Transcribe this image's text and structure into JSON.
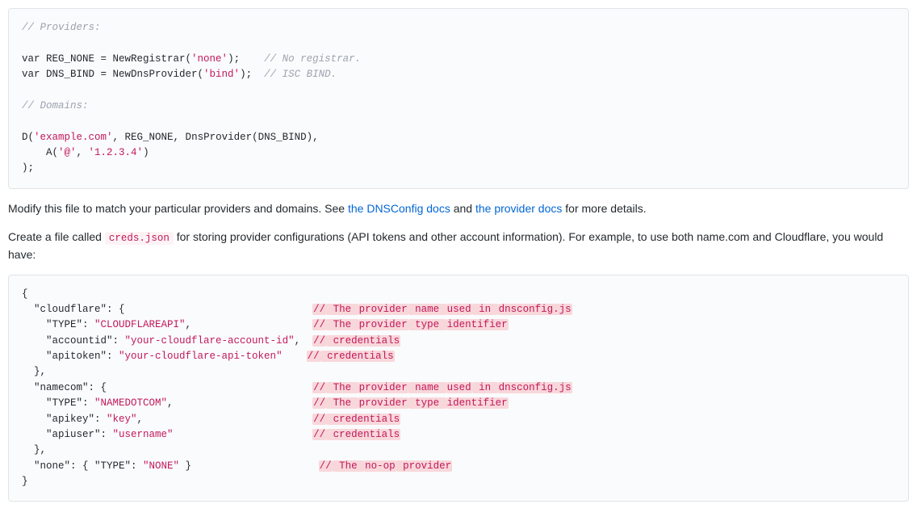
{
  "code1": {
    "c1": "// Providers:",
    "l1a": "var REG_NONE = NewRegistrar(",
    "l1s": "'none'",
    "l1b": ");    ",
    "l1c": "// No registrar.",
    "l2a": "var DNS_BIND = NewDnsProvider(",
    "l2s": "'bind'",
    "l2b": ");  ",
    "l2c": "// ISC BIND.",
    "c2": "// Domains:",
    "l3a": "D(",
    "l3s": "'example.com'",
    "l3b": ", REG_NONE, DnsProvider(DNS_BIND),",
    "l4a": "    A(",
    "l4s1": "'@'",
    "l4m": ", ",
    "l4s2": "'1.2.3.4'",
    "l4b": ")",
    "l5": ");"
  },
  "p1": {
    "t1": "Modify this file to match your particular providers and domains. See ",
    "link1": "the DNSConfig docs",
    "t2": " and ",
    "link2": "the provider docs",
    "t3": " for more details."
  },
  "p2": {
    "t1": "Create a file called ",
    "code": "creds.json",
    "t2": " for storing provider configurations (API tokens and other account information). For example, to use both name.com and Cloudflare, you would have:"
  },
  "code2": {
    "open": "{",
    "cf_k": "  \"cloudflare\": {                               ",
    "cf_c": [
      "//",
      " The ",
      "provider",
      " name ",
      "used",
      " in ",
      "dnsconfig.js"
    ],
    "cf_t": "    \"TYPE\": ",
    "cf_tv": "\"CLOUDFLAREAPI\"",
    "cf_tp": ",                    ",
    "cf_tc": [
      "//",
      " The ",
      "provider",
      " type ",
      "identifier"
    ],
    "cf_a": "    \"accountid\": ",
    "cf_av": "\"your-cloudflare-account-id\"",
    "cf_ap": ",  ",
    "cf_ac": [
      "//",
      " credentials"
    ],
    "cf_p": "    \"apitoken\": ",
    "cf_pv": "\"your-cloudflare-api-token\"",
    "cf_pp": "    ",
    "cf_pc": [
      "//",
      " credentials"
    ],
    "cf_close": "  },",
    "nc_k": "  \"namecom\": {                                  ",
    "nc_c": [
      "//",
      " The ",
      "provider",
      " name ",
      "used",
      " in ",
      "dnsconfig.js"
    ],
    "nc_t": "    \"TYPE\": ",
    "nc_tv": "\"NAMEDOTCOM\"",
    "nc_tp": ",                       ",
    "nc_tc": [
      "//",
      " The ",
      "provider",
      " type ",
      "identifier"
    ],
    "nc_a": "    \"apikey\": ",
    "nc_av": "\"key\"",
    "nc_ap": ",                            ",
    "nc_ac": [
      "//",
      " credentials"
    ],
    "nc_u": "    \"apiuser\": ",
    "nc_uv": "\"username\"",
    "nc_up": "                       ",
    "nc_uc": [
      "//",
      " credentials"
    ],
    "nc_close": "  },",
    "none_a": "  \"none\": { \"TYPE\": ",
    "none_v": "\"NONE\"",
    "none_b": " }                     ",
    "none_c": [
      "//",
      " The ",
      "no-op",
      " provider"
    ],
    "close": "}"
  }
}
